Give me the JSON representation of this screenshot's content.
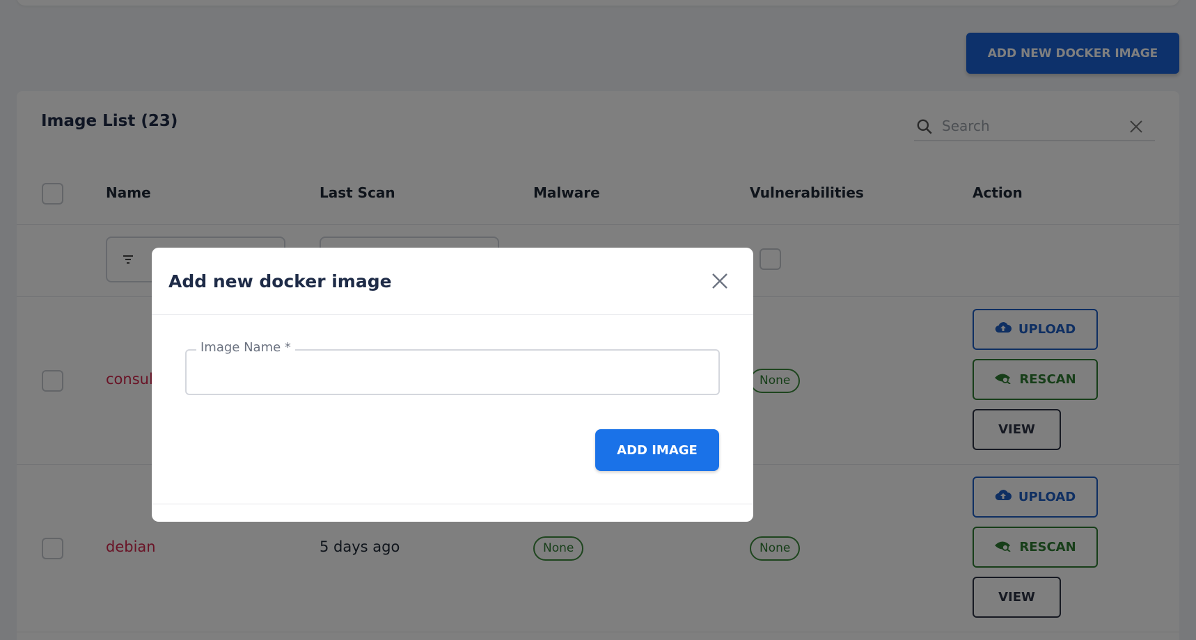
{
  "page": {
    "add_docker_button": "ADD NEW DOCKER IMAGE"
  },
  "list": {
    "title": "Image List (23)",
    "search_placeholder": "Search",
    "columns": [
      "Name",
      "Last Scan",
      "Malware",
      "Vulnerabilities",
      "Action"
    ],
    "rows": [
      {
        "name": "consul",
        "last_scan": "",
        "malware": "",
        "vulnerabilities": "None"
      },
      {
        "name": "debian",
        "last_scan": "5 days ago",
        "malware": "None",
        "vulnerabilities": "None"
      }
    ],
    "actions": {
      "upload": "UPLOAD",
      "rescan": "RESCAN",
      "view": "VIEW"
    }
  },
  "modal": {
    "title": "Add new docker image",
    "field_label": "Image Name *",
    "field_value": "",
    "submit": "ADD IMAGE"
  },
  "icons": {
    "search": "search-icon",
    "clear": "close-icon",
    "filter": "filter-icon",
    "upload": "cloud-upload-icon",
    "rescan": "eye-scan-icon"
  },
  "colors": {
    "primary": "#1a63d6",
    "link_red": "#d3264c",
    "success_green": "#2e7d32"
  }
}
